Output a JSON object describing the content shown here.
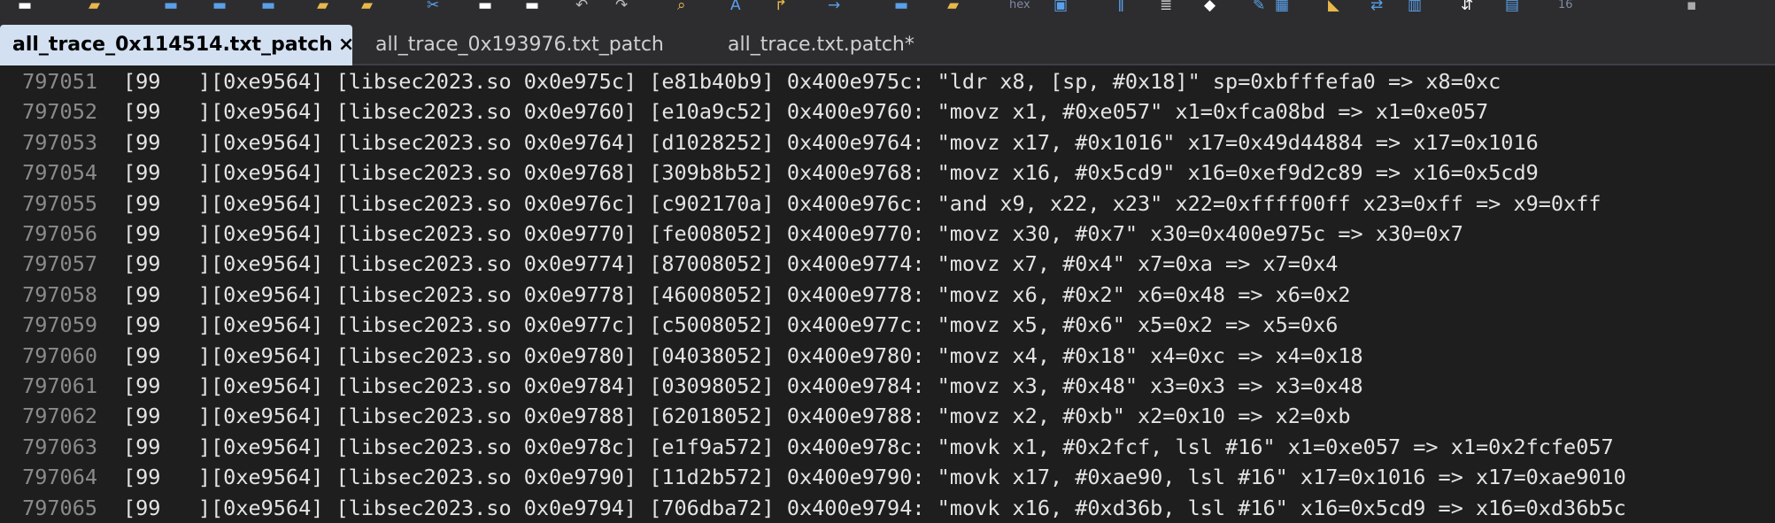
{
  "toolbar": {
    "icons": [
      {
        "name": "new-file-icon",
        "glyph": "▬",
        "color": "#ffffff"
      },
      {
        "name": "open-folder-icon",
        "glyph": "▰",
        "color": "#e8b84a"
      },
      {
        "name": "save-icon",
        "glyph": "▬",
        "color": "#5aa0e8"
      },
      {
        "name": "save-as-icon",
        "glyph": "▬",
        "color": "#5aa0e8"
      },
      {
        "name": "save-all-icon",
        "glyph": "▬",
        "color": "#5aa0e8"
      },
      {
        "name": "folder-icon",
        "glyph": "▰",
        "color": "#e8b84a"
      },
      {
        "name": "folder-open-icon",
        "glyph": "▰",
        "color": "#e8b84a"
      },
      {
        "name": "cut-icon",
        "glyph": "✂",
        "color": "#5aa0e8"
      },
      {
        "name": "copy-icon",
        "glyph": "▬",
        "color": "#ffffff"
      },
      {
        "name": "paste-icon",
        "glyph": "▬",
        "color": "#ffffff"
      },
      {
        "name": "undo-icon",
        "glyph": "↶",
        "color": "#bbbbbb"
      },
      {
        "name": "redo-icon",
        "glyph": "↷",
        "color": "#bbbbbb"
      },
      {
        "name": "find-icon",
        "glyph": "⌕",
        "color": "#e8b84a"
      },
      {
        "name": "replace-icon",
        "glyph": "A",
        "color": "#5aa0e8"
      },
      {
        "name": "find-next-icon",
        "glyph": "↱",
        "color": "#e8b84a"
      },
      {
        "name": "goto-icon",
        "glyph": "→",
        "color": "#5aa0e8"
      },
      {
        "name": "bookmark-icon",
        "glyph": "▬",
        "color": "#5aa0e8"
      },
      {
        "name": "mark-icon",
        "glyph": "▰",
        "color": "#e8b84a"
      },
      {
        "name": "hex-icon",
        "glyph": "hex",
        "color": "#7f8aa0",
        "text": true
      },
      {
        "name": "word-wrap-icon",
        "glyph": "▣",
        "color": "#5aa0e8"
      },
      {
        "name": "column-icon",
        "glyph": "‖",
        "color": "#5aa0e8"
      },
      {
        "name": "list-icon",
        "glyph": "≣",
        "color": "#cccccc"
      },
      {
        "name": "eraser-icon",
        "glyph": "◆",
        "color": "#ffffff"
      },
      {
        "name": "spellcheck-icon",
        "glyph": "✎",
        "color": "#5aa0e8"
      },
      {
        "name": "table-icon",
        "glyph": "▦",
        "color": "#5aa0e8"
      },
      {
        "name": "highlight-icon",
        "glyph": "◣",
        "color": "#e8b84a"
      },
      {
        "name": "compare-icon",
        "glyph": "⇄",
        "color": "#5aa0e8"
      },
      {
        "name": "chart-icon",
        "glyph": "▥",
        "color": "#5aa0e8"
      },
      {
        "name": "sort-icon",
        "glyph": "⇵",
        "color": "#ffffff"
      },
      {
        "name": "script-icon",
        "glyph": "▤",
        "color": "#5aa0e8"
      },
      {
        "name": "font-size-icon",
        "glyph": "16",
        "color": "#7f8aa0",
        "text": true
      },
      {
        "name": "settings-icon",
        "glyph": "▪",
        "color": "#aaaaaa"
      }
    ]
  },
  "tabs": [
    {
      "label": "all_trace_0x114514.txt_patch",
      "active": true,
      "close": "×"
    },
    {
      "label": "all_trace_0x193976.txt_patch",
      "active": false
    },
    {
      "label": "all_trace.txt.patch*",
      "active": false
    }
  ],
  "editor": {
    "lines": [
      {
        "number": "797051",
        "text": "[99   ][0xe9564] [libsec2023.so 0x0e975c] [e81b40b9] 0x400e975c: \"ldr x8, [sp, #0x18]\" sp=0xbfffefa0 => x8=0xc"
      },
      {
        "number": "797052",
        "text": "[99   ][0xe9564] [libsec2023.so 0x0e9760] [e10a9c52] 0x400e9760: \"movz x1, #0xe057\" x1=0xfca08bd => x1=0xe057"
      },
      {
        "number": "797053",
        "text": "[99   ][0xe9564] [libsec2023.so 0x0e9764] [d1028252] 0x400e9764: \"movz x17, #0x1016\" x17=0x49d44884 => x17=0x1016"
      },
      {
        "number": "797054",
        "text": "[99   ][0xe9564] [libsec2023.so 0x0e9768] [309b8b52] 0x400e9768: \"movz x16, #0x5cd9\" x16=0xef9d2c89 => x16=0x5cd9"
      },
      {
        "number": "797055",
        "text": "[99   ][0xe9564] [libsec2023.so 0x0e976c] [c902170a] 0x400e976c: \"and x9, x22, x23\" x22=0xffff00ff x23=0xff => x9=0xff"
      },
      {
        "number": "797056",
        "text": "[99   ][0xe9564] [libsec2023.so 0x0e9770] [fe008052] 0x400e9770: \"movz x30, #0x7\" x30=0x400e975c => x30=0x7"
      },
      {
        "number": "797057",
        "text": "[99   ][0xe9564] [libsec2023.so 0x0e9774] [87008052] 0x400e9774: \"movz x7, #0x4\" x7=0xa => x7=0x4"
      },
      {
        "number": "797058",
        "text": "[99   ][0xe9564] [libsec2023.so 0x0e9778] [46008052] 0x400e9778: \"movz x6, #0x2\" x6=0x48 => x6=0x2"
      },
      {
        "number": "797059",
        "text": "[99   ][0xe9564] [libsec2023.so 0x0e977c] [c5008052] 0x400e977c: \"movz x5, #0x6\" x5=0x2 => x5=0x6"
      },
      {
        "number": "797060",
        "text": "[99   ][0xe9564] [libsec2023.so 0x0e9780] [04038052] 0x400e9780: \"movz x4, #0x18\" x4=0xc => x4=0x18"
      },
      {
        "number": "797061",
        "text": "[99   ][0xe9564] [libsec2023.so 0x0e9784] [03098052] 0x400e9784: \"movz x3, #0x48\" x3=0x3 => x3=0x48"
      },
      {
        "number": "797062",
        "text": "[99   ][0xe9564] [libsec2023.so 0x0e9788] [62018052] 0x400e9788: \"movz x2, #0xb\" x2=0x10 => x2=0xb"
      },
      {
        "number": "797063",
        "text": "[99   ][0xe9564] [libsec2023.so 0x0e978c] [e1f9a572] 0x400e978c: \"movk x1, #0x2fcf, lsl #16\" x1=0xe057 => x1=0x2fcfe057"
      },
      {
        "number": "797064",
        "text": "[99   ][0xe9564] [libsec2023.so 0x0e9790] [11d2b572] 0x400e9790: \"movk x17, #0xae90, lsl #16\" x17=0x1016 => x17=0xae9010"
      },
      {
        "number": "797065",
        "text": "[99   ][0xe9564] [libsec2023.so 0x0e9794] [706dba72] 0x400e9794: \"movk x16, #0xd36b, lsl #16\" x16=0x5cd9 => x16=0xd36b5c"
      }
    ]
  }
}
